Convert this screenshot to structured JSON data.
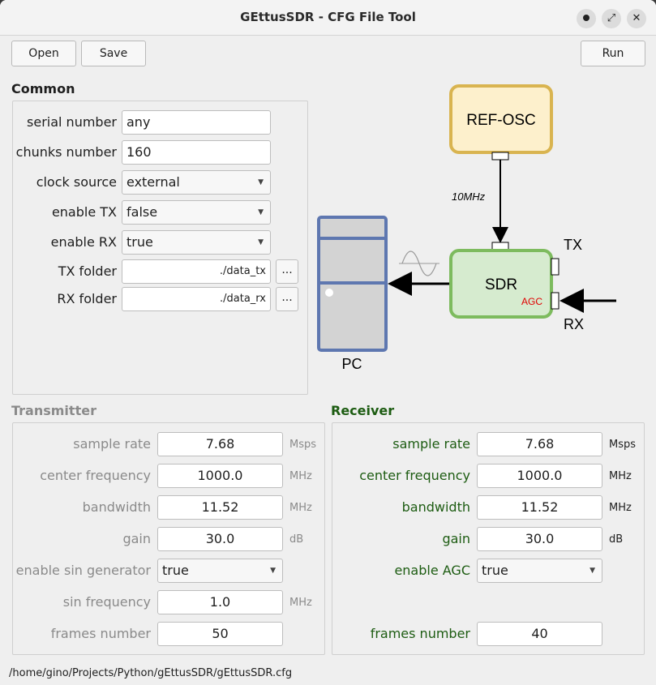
{
  "window": {
    "title": "GEttusSDR - CFG File Tool",
    "minimize_icon": "●",
    "maximize_icon": "⤢",
    "close_icon": "✕"
  },
  "toolbar": {
    "open_label": "Open",
    "save_label": "Save",
    "run_label": "Run"
  },
  "common": {
    "title": "Common",
    "serial_number": {
      "label": "serial number",
      "value": "any"
    },
    "chunks_number": {
      "label": "chunks number",
      "value": "160"
    },
    "clock_source": {
      "label": "clock source",
      "value": "external"
    },
    "enable_tx": {
      "label": "enable TX",
      "value": "false"
    },
    "enable_rx": {
      "label": "enable RX",
      "value": "true"
    },
    "tx_folder": {
      "label": "TX folder",
      "value": "./data_tx",
      "browse_label": "..."
    },
    "rx_folder": {
      "label": "RX folder",
      "value": "./data_rx",
      "browse_label": "..."
    }
  },
  "diagram": {
    "ref_osc_label": "REF-OSC",
    "freq_label": "10MHz",
    "sdr_label": "SDR",
    "agc_label": "AGC",
    "tx_label": "TX",
    "rx_label": "RX",
    "pc_label": "PC",
    "colors": {
      "ref_osc_fill": "#fdf0cc",
      "ref_osc_stroke": "#d9b450",
      "sdr_fill": "#d6ebcf",
      "sdr_stroke": "#7dbb5e",
      "pc_fill": "#d3d3d3",
      "pc_stroke": "#5e77b0",
      "agc": "#e00000"
    }
  },
  "transmitter": {
    "title": "Transmitter",
    "sample_rate": {
      "label": "sample rate",
      "value": "7.68",
      "unit": "Msps"
    },
    "center_frequency": {
      "label": "center frequency",
      "value": "1000.0",
      "unit": "MHz"
    },
    "bandwidth": {
      "label": "bandwidth",
      "value": "11.52",
      "unit": "MHz"
    },
    "gain": {
      "label": "gain",
      "value": "30.0",
      "unit": "dB"
    },
    "sin_generator": {
      "label": "enable sin generator",
      "value": "true"
    },
    "sin_frequency": {
      "label": "sin frequency",
      "value": "1.0",
      "unit": "MHz"
    },
    "frames_number": {
      "label": "frames number",
      "value": "50"
    }
  },
  "receiver": {
    "title": "Receiver",
    "sample_rate": {
      "label": "sample rate",
      "value": "7.68",
      "unit": "Msps"
    },
    "center_frequency": {
      "label": "center frequency",
      "value": "1000.0",
      "unit": "MHz"
    },
    "bandwidth": {
      "label": "bandwidth",
      "value": "11.52",
      "unit": "MHz"
    },
    "gain": {
      "label": "gain",
      "value": "30.0",
      "unit": "dB"
    },
    "agc": {
      "label": "enable AGC",
      "value": "true"
    },
    "frames_number": {
      "label": "frames number",
      "value": "40"
    }
  },
  "status": {
    "path": "/home/gino/Projects/Python/gEttusSDR/gEttusSDR.cfg"
  }
}
